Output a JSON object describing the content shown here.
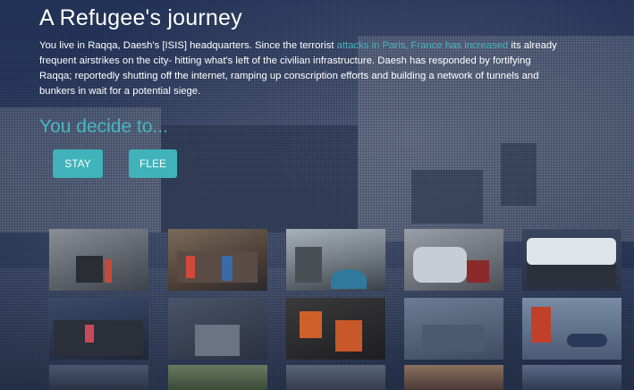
{
  "page": {
    "title": "A Refugee's journey",
    "intro_before": "You live in Raqqa, Daesh's [ISIS] headquarters. Since the terrorist ",
    "intro_link": "attacks in Paris, France has increased",
    "intro_after": " its already frequent airstrikes on the city- hitting what's left of the civilian infrastructure. Daesh has responded by fortifying Raqqa; reportedly shutting off the internet, ramping up conscription efforts and building a network of tunnels and bunkers in wait for a potential siege.",
    "decide_label": "You decide to...",
    "stay_label": "STAY",
    "flee_label": "FLEE"
  },
  "colors": {
    "accent": "#48b6c0",
    "button": "#3fb3b9"
  },
  "gallery_count": 15
}
